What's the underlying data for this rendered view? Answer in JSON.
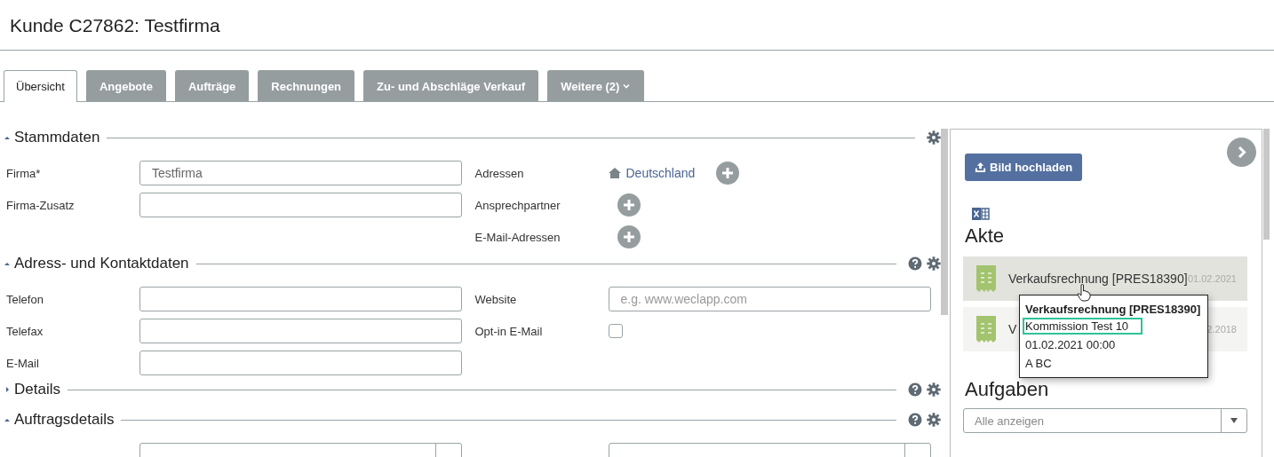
{
  "title": "Kunde C27862: Testfirma",
  "tabs": [
    {
      "label": "Übersicht",
      "selected": true,
      "menu": false
    },
    {
      "label": "Angebote",
      "selected": false,
      "menu": false
    },
    {
      "label": "Aufträge",
      "selected": false,
      "menu": false
    },
    {
      "label": "Rechnungen",
      "selected": false,
      "menu": false
    },
    {
      "label": "Zu- und Abschläge Verkauf",
      "selected": false,
      "menu": false
    },
    {
      "label": "Weitere (2)",
      "selected": false,
      "menu": true
    }
  ],
  "sections": [
    {
      "title": "Stammdaten",
      "expanded": true,
      "help": false,
      "rows": [
        {
          "left": {
            "kind": "text",
            "label": "Firma*",
            "value": "Testfirma"
          },
          "right": {
            "kind": "link",
            "label": "Adressen",
            "value": "Deutschland"
          }
        },
        {
          "left": {
            "kind": "text",
            "label": "Firma-Zusatz"
          },
          "right": {
            "kind": "add",
            "label": "Ansprechpartner"
          }
        },
        {
          "left": {
            "kind": "none"
          },
          "right": {
            "kind": "add",
            "label": "E-Mail-Adressen"
          }
        }
      ]
    },
    {
      "title": "Adress- und Kontaktdaten",
      "expanded": true,
      "help": true,
      "rows": [
        {
          "left": {
            "kind": "text",
            "label": "Telefon"
          },
          "right": {
            "kind": "text",
            "label": "Website",
            "placeholder": "e.g. www.weclapp.com"
          }
        },
        {
          "left": {
            "kind": "text",
            "label": "Telefax"
          },
          "right": {
            "kind": "checkbox",
            "label": "Opt-in E-Mail",
            "checked": false
          }
        },
        {
          "left": {
            "kind": "text",
            "label": "E-Mail"
          },
          "right": {
            "kind": "none"
          }
        }
      ]
    },
    {
      "title": "Details",
      "expanded": false,
      "help": true
    },
    {
      "title": "Auftragsdetails",
      "expanded": true,
      "help": true,
      "rows": [
        {
          "left": {
            "kind": "select"
          },
          "right": {
            "kind": "select"
          }
        }
      ]
    }
  ],
  "side": {
    "upload": "Bild hochladen",
    "akte": "Akte",
    "documents": [
      {
        "title": "Verkaufsrechnung [PRES18390]",
        "date": "01.02.2021",
        "hovered": true
      },
      {
        "title": "V",
        "date": "2.2018",
        "hovered": false
      }
    ],
    "tooltip": {
      "title": "Verkaufsrechnung [PRES18390]",
      "lines": [
        {
          "text": "Kommission Test 10",
          "highlighted": true
        },
        {
          "text": "01.02.2021 00:00",
          "highlighted": false
        },
        {
          "text": "A BC",
          "highlighted": false
        }
      ]
    },
    "tasks": "Aufgaben",
    "filter": "Alle anzeigen"
  }
}
